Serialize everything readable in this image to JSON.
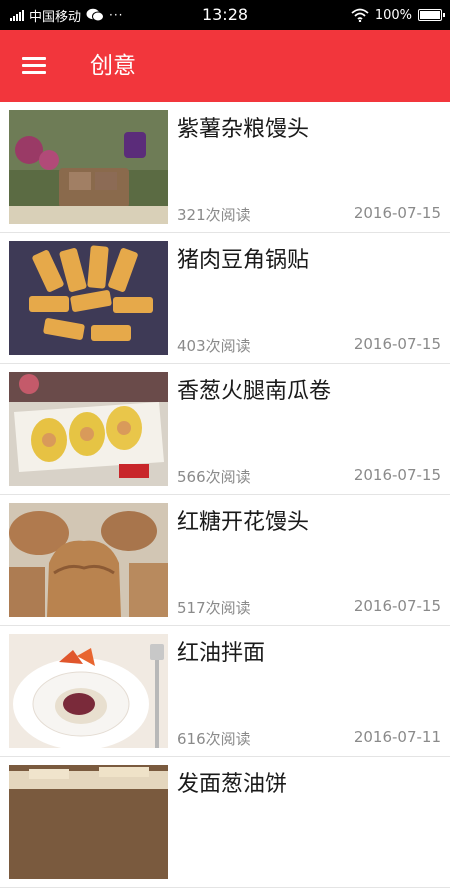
{
  "status_bar": {
    "carrier": "中国移动",
    "time": "13:28",
    "battery": "100%",
    "icons": [
      "signal-icon",
      "wechat-icon",
      "more-dots-icon",
      "wifi-icon",
      "battery-icon"
    ]
  },
  "app_bar": {
    "title": "创意",
    "menu_icon": "hamburger-menu-icon",
    "background": "#f2363c"
  },
  "articles": [
    {
      "title": "紫薯杂粮馒头",
      "reads": "321次阅读",
      "date": "2016-07-15"
    },
    {
      "title": "猪肉豆角锅贴",
      "reads": "403次阅读",
      "date": "2016-07-15"
    },
    {
      "title": "香葱火腿南瓜卷",
      "reads": "566次阅读",
      "date": "2016-07-15"
    },
    {
      "title": "红糖开花馒头",
      "reads": "517次阅读",
      "date": "2016-07-15"
    },
    {
      "title": "红油拌面",
      "reads": "616次阅读",
      "date": "2016-07-11"
    },
    {
      "title": "发面葱油饼",
      "reads": "",
      "date": ""
    }
  ]
}
